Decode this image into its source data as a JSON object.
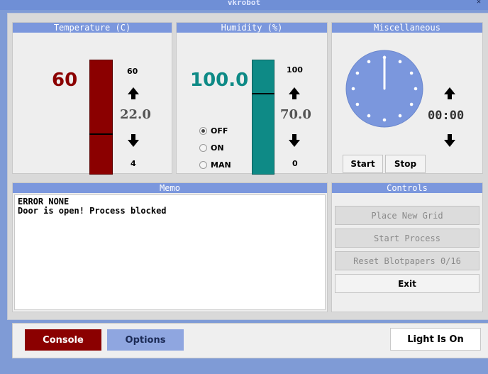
{
  "window": {
    "title": "vkrobot"
  },
  "temperature": {
    "header": "Temperature (C)",
    "current": "60",
    "max": "60",
    "setpoint": "22.0",
    "min": "4",
    "bar_color": "#8b0000",
    "bar_level": 0.27
  },
  "humidity": {
    "header": "Humidity (%)",
    "current": "100.0",
    "max": "100",
    "setpoint": "70.0",
    "min": "0",
    "bar_color": "#0e8a86",
    "bar_level": 0.7,
    "modes": [
      {
        "label": "OFF",
        "selected": true
      },
      {
        "label": "ON",
        "selected": false
      },
      {
        "label": "MAN",
        "selected": false
      }
    ]
  },
  "misc": {
    "header": "Miscellaneous",
    "timer": "00:00",
    "start_label": "Start",
    "stop_label": "Stop",
    "clock_color": "#7b97dd"
  },
  "memo": {
    "header": "Memo",
    "lines": [
      "ERROR NONE",
      "Door is open! Process blocked"
    ]
  },
  "controls": {
    "header": "Controls",
    "buttons": [
      {
        "label": "Place New Grid",
        "enabled": false
      },
      {
        "label": "Start Process",
        "enabled": false
      },
      {
        "label": "Reset Blotpapers 0/16",
        "enabled": false
      },
      {
        "label": "Exit",
        "enabled": true
      }
    ]
  },
  "bottom": {
    "console_label": "Console",
    "options_label": "Options",
    "light_label": "Light Is On"
  },
  "colors": {
    "accent": "#7b97dd",
    "temp": "#8b0000",
    "humidity": "#0e8a86",
    "console": "#8b0000"
  }
}
